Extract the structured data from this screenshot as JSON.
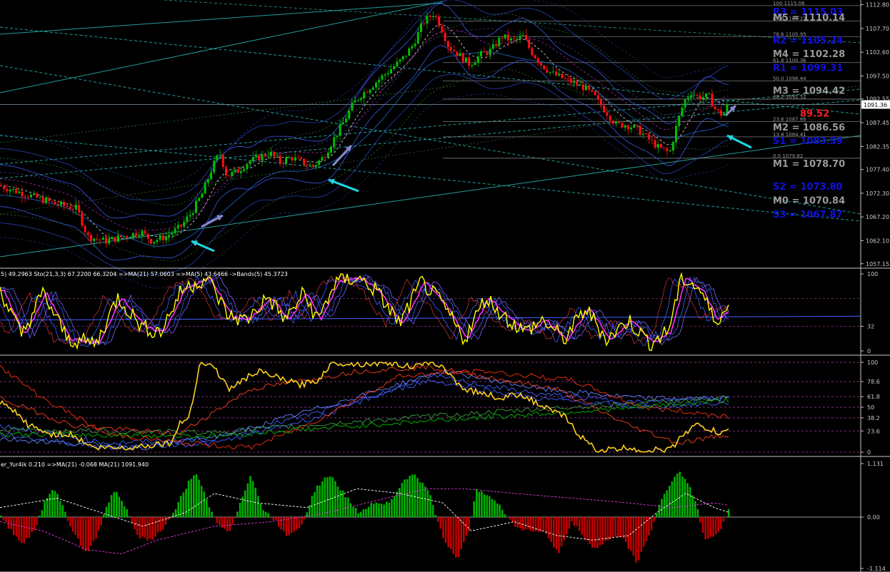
{
  "chart_data": [
    {
      "type": "candlestick",
      "panel": "price",
      "current_price": "1091.36",
      "y_ticks": [
        "1112.80",
        "1107.70",
        "1102.60",
        "1097.50",
        "1092.55",
        "1087.45",
        "1082.35",
        "1077.40",
        "1072.30",
        "1067.20",
        "1062.10",
        "1057.15"
      ],
      "y_values": [
        1112.8,
        1107.7,
        1102.6,
        1097.5,
        1092.55,
        1087.45,
        1082.35,
        1077.4,
        1072.3,
        1067.2,
        1062.1,
        1057.15
      ],
      "ylim": [
        1056.5,
        1113.5
      ],
      "close_path": [
        [
          0,
          1074
        ],
        [
          40,
          1072
        ],
        [
          80,
          1070
        ],
        [
          110,
          1069
        ],
        [
          125,
          1063
        ],
        [
          150,
          1062
        ],
        [
          175,
          1063
        ],
        [
          200,
          1064
        ],
        [
          215,
          1062
        ],
        [
          235,
          1063
        ],
        [
          255,
          1065
        ],
        [
          270,
          1068
        ],
        [
          285,
          1072
        ],
        [
          300,
          1078
        ],
        [
          310,
          1081
        ],
        [
          320,
          1076
        ],
        [
          335,
          1077
        ],
        [
          350,
          1079
        ],
        [
          365,
          1080
        ],
        [
          380,
          1081
        ],
        [
          395,
          1079
        ],
        [
          410,
          1080
        ],
        [
          425,
          1079
        ],
        [
          440,
          1078
        ],
        [
          455,
          1080
        ],
        [
          470,
          1084
        ],
        [
          485,
          1088
        ],
        [
          495,
          1091
        ],
        [
          505,
          1093
        ],
        [
          520,
          1095
        ],
        [
          535,
          1097
        ],
        [
          550,
          1099
        ],
        [
          565,
          1101
        ],
        [
          580,
          1104
        ],
        [
          595,
          1109
        ],
        [
          610,
          1111
        ],
        [
          620,
          1108
        ],
        [
          630,
          1104
        ],
        [
          645,
          1102
        ],
        [
          660,
          1100
        ],
        [
          675,
          1102
        ],
        [
          690,
          1103
        ],
        [
          705,
          1106
        ],
        [
          720,
          1105
        ],
        [
          735,
          1106
        ],
        [
          745,
          1103
        ],
        [
          760,
          1100
        ],
        [
          775,
          1098
        ],
        [
          790,
          1097
        ],
        [
          805,
          1096
        ],
        [
          820,
          1095
        ],
        [
          835,
          1093
        ],
        [
          850,
          1090
        ],
        [
          865,
          1087
        ],
        [
          880,
          1087
        ],
        [
          895,
          1086
        ],
        [
          910,
          1084
        ],
        [
          925,
          1082
        ],
        [
          940,
          1081
        ],
        [
          950,
          1087
        ],
        [
          960,
          1092
        ],
        [
          970,
          1094
        ],
        [
          980,
          1093
        ],
        [
          995,
          1093
        ],
        [
          1005,
          1090
        ],
        [
          1015,
          1089
        ],
        [
          1020,
          1091
        ]
      ],
      "pivot_levels": [
        {
          "name": "R3",
          "text": "R3 = 1115.03",
          "value": 1115.03,
          "color": "#1010e0"
        },
        {
          "name": "M5",
          "text": "M5 = 1110.14",
          "value": 1110.14,
          "color": "#9a9a9a"
        },
        {
          "name": "R2",
          "text": "R2 = 1105.24",
          "value": 1105.24,
          "color": "#1010e0"
        },
        {
          "name": "M4",
          "text": "M4 = 1102.28",
          "value": 1102.28,
          "color": "#9a9a9a"
        },
        {
          "name": "R1",
          "text": "R1 = 1099.31",
          "value": 1099.31,
          "color": "#1010e0"
        },
        {
          "name": "M3",
          "text": "M3 = 1094.42",
          "value": 1094.42,
          "color": "#9a9a9a"
        },
        {
          "name": "PP",
          "text": "89.52",
          "value": 1089.52,
          "color": "#ff2020"
        },
        {
          "name": "M2",
          "text": "M2 = 1086.56",
          "value": 1086.56,
          "color": "#9a9a9a"
        },
        {
          "name": "S1",
          "text": "S1 = 1083.59",
          "value": 1083.59,
          "color": "#1010e0"
        },
        {
          "name": "M1",
          "text": "M1 = 1078.70",
          "value": 1078.7,
          "color": "#9a9a9a"
        },
        {
          "name": "S2",
          "text": "S2 = 1073.80",
          "value": 1073.8,
          "color": "#1010e0"
        },
        {
          "name": "M0",
          "text": "M0 = 1070.84",
          "value": 1070.84,
          "color": "#9a9a9a"
        },
        {
          "name": "S3",
          "text": "S3 = 1067.87",
          "value": 1067.87,
          "color": "#1010e0"
        }
      ],
      "fib_levels": [
        {
          "text": "100 1115.06",
          "value": 1112.6
        },
        {
          "text": "88.6 1109.27",
          "value": 1109.27
        },
        {
          "text": "78.6 1105.95",
          "value": 1105.95
        },
        {
          "text": "61.8 1100.36",
          "value": 1100.36
        },
        {
          "text": "50.0 1096.44",
          "value": 1096.44
        },
        {
          "text": "38.2 1092.52",
          "value": 1092.52
        },
        {
          "text": "23.6 1087.66",
          "value": 1087.66
        },
        {
          "text": "13.8 1084.41",
          "value": 1084.41
        },
        {
          "text": "0.0 1079.82",
          "value": 1079.82
        }
      ],
      "colors": {
        "bull": "#00c000",
        "bear": "#ff1010",
        "fib": "#9a9a9a",
        "trend": "#40c0c0",
        "arrow": "#20d8e0"
      }
    },
    {
      "type": "line",
      "panel": "stochastic",
      "label": "5) 49.2963  Sto(21,3,3) 67.2200 66.3204  =>MA(21) 57.0603  =>MA(5) 43.6466  ->Bands(5) 45.3723",
      "y_ticks": [
        "100",
        "32",
        "0"
      ],
      "y_values": [
        100,
        32,
        0
      ],
      "ylim": [
        0,
        100
      ]
    },
    {
      "type": "line",
      "panel": "oscillator",
      "y_ticks": [
        "100",
        "78.6",
        "61.8",
        "50",
        "38.2",
        "23.6",
        "0"
      ],
      "y_values": [
        100,
        78.6,
        61.8,
        50,
        38.2,
        23.6,
        0
      ],
      "ylim": [
        0,
        100
      ]
    },
    {
      "type": "bar",
      "panel": "histogram",
      "label": "er_Yur4ik 0.210  =>MA(21) -0.068  MA(21) 1091.940",
      "y_ticks": [
        "1.131",
        "0.00",
        "-1.114"
      ],
      "y_values": [
        1.131,
        0,
        -1.114
      ],
      "ylim": [
        -1.114,
        1.131
      ],
      "colors": {
        "positive": "#00b000",
        "negative": "#c00000"
      }
    }
  ]
}
